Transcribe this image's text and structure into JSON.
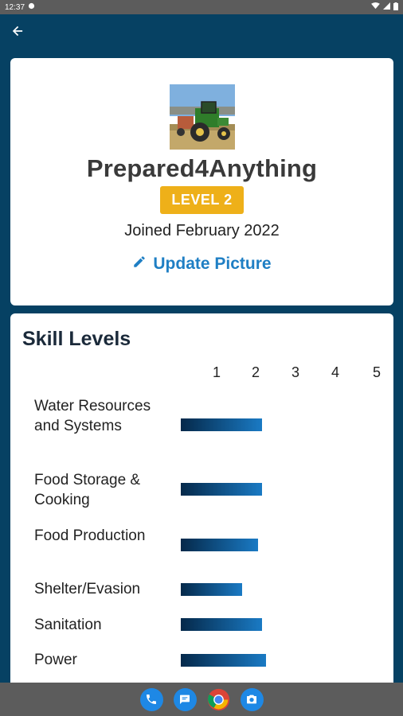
{
  "status_bar": {
    "time": "12:37"
  },
  "app_bar": {
    "back_icon": "arrow-back-icon"
  },
  "profile": {
    "username": "Prepared4Anything",
    "level": "LEVEL 2",
    "joined": "Joined February 2022",
    "update_picture": "Update Picture",
    "badge_color": "#eeb019",
    "link_color": "#1f7fc4"
  },
  "skills": {
    "title": "Skill Levels",
    "scale": [
      "1",
      "2",
      "3",
      "4",
      "5"
    ],
    "items": [
      {
        "label": "Water Resources and Systems",
        "level": 2.0
      },
      {
        "label": "Food Storage & Cooking",
        "level": 2.0
      },
      {
        "label": "Food Production",
        "level": 1.9
      },
      {
        "label": "Shelter/Evasion",
        "level": 1.5
      },
      {
        "label": "Sanitation",
        "level": 2.0
      },
      {
        "label": "Power",
        "level": 2.1
      }
    ]
  },
  "nav_bar": {
    "apps": [
      "phone-icon",
      "messages-icon",
      "chrome-icon",
      "camera-icon"
    ]
  }
}
